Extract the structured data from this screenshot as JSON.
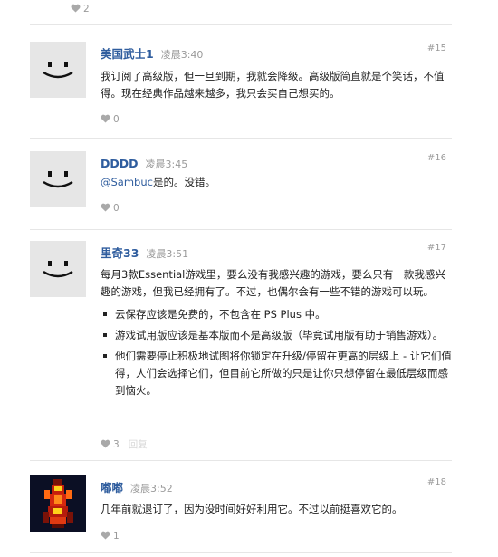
{
  "colors": {
    "username": "#2f5d9e",
    "meta": "#9a9a9a",
    "separator": "#e6e6e6",
    "avatar_bg": "#e6e6e6"
  },
  "top_partial": {
    "likes": "2"
  },
  "posts": [
    {
      "username": "美国武士1",
      "time": "凌晨3:40",
      "number": "#15",
      "avatar": "smiley-avatar",
      "paragraphs": [
        "我订阅了高级版，但一旦到期，我就会降级。高级版简直就是个笑话，不值得。现在经典作品越来越多，我只会买自己想买的。"
      ],
      "likes": "0"
    },
    {
      "username": "DDDD",
      "time": "凌晨3:45",
      "number": "#16",
      "avatar": "smiley-avatar",
      "mention": "@Sambuc",
      "text": "是的。没错。",
      "likes": "0"
    },
    {
      "username": "里奇33",
      "time": "凌晨3:51",
      "number": "#17",
      "avatar": "smiley-avatar",
      "paragraphs": [
        "每月3款Essential游戏里，要么没有我感兴趣的游戏，要么只有一款我感兴趣的游戏，但我已经拥有了。不过，也偶尔会有一些不错的游戏可以玩。"
      ],
      "bullets": [
        "云保存应该是免费的，不包含在 PS Plus 中。",
        "游戏试用版应该是基本版而不是高级版（毕竟试用版有助于销售游戏）。",
        "他们需要停止积极地试图将你锁定在升级/停留在更高的层级上 - 让它们值得，人们会选择它们，但目前它所做的只是让你只想停留在最低层级而感到恼火。"
      ],
      "likes": "3",
      "reply": "回复"
    },
    {
      "username": "嘟嘟",
      "time": "凌晨3:52",
      "number": "#18",
      "avatar": "pixel-race-car-avatar",
      "paragraphs": [
        "几年前就退订了，因为没时间好好利用它。不过以前挺喜欢它的。"
      ],
      "likes": "1"
    }
  ]
}
